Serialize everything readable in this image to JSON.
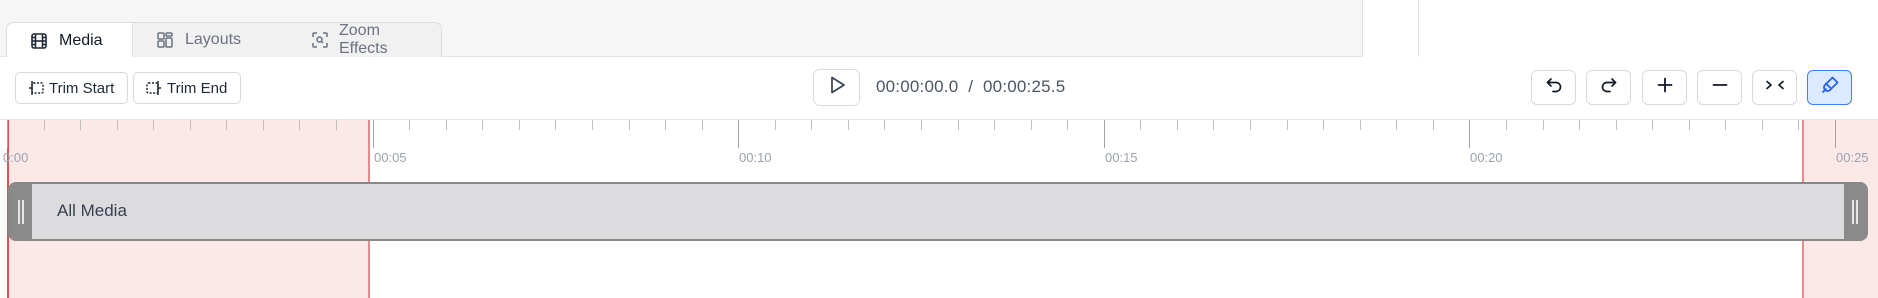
{
  "tabs": [
    {
      "label": "Media",
      "icon": "film-icon",
      "active": true
    },
    {
      "label": "Layouts",
      "icon": "layout-grid-icon",
      "active": false
    },
    {
      "label": "Zoom Effects",
      "icon": "zoom-focus-icon",
      "active": false
    }
  ],
  "toolbar": {
    "trim_start_label": "Trim Start",
    "trim_end_label": "Trim End",
    "current_time": "00:00:00.0",
    "separator": "/",
    "total_time": "00:00:25.5",
    "icons": [
      "undo-icon",
      "redo-icon",
      "zoom-in-plus-icon",
      "zoom-out-minus-icon",
      "collapse-icon",
      "magnet-snap-icon"
    ],
    "snap_active": true
  },
  "timeline": {
    "ruler_labels": [
      "0:00",
      "00:05",
      "00:10",
      "00:15",
      "00:20",
      "00:25"
    ],
    "duration_seconds": 25.5,
    "trim_start_seconds": 5,
    "trim_end_seconds": 24.7,
    "clip_label": "All Media"
  },
  "colors": {
    "accent": "#3b82f6",
    "trim_overlay": "#fce8e7",
    "trim_line": "#e05252"
  }
}
